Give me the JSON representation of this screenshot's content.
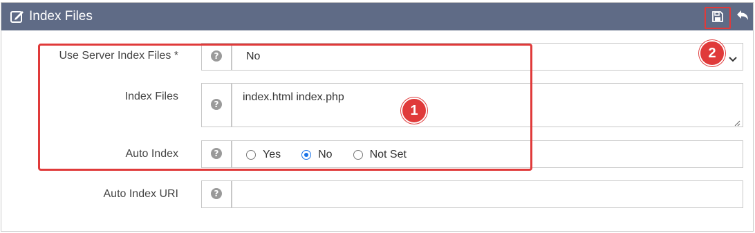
{
  "header": {
    "title": "Index Files",
    "icons": {
      "edit": "edit-icon",
      "save": "save-icon",
      "undo": "undo-icon"
    }
  },
  "fields": {
    "use_server_index": {
      "label": "Use Server Index Files *",
      "value": "No"
    },
    "index_files": {
      "label": "Index Files",
      "value": "index.html index.php"
    },
    "auto_index": {
      "label": "Auto Index",
      "options": [
        "Yes",
        "No",
        "Not Set"
      ],
      "selected": "No"
    },
    "auto_index_uri": {
      "label": "Auto Index URI",
      "value": ""
    }
  },
  "help_glyph": "?",
  "annotations": {
    "badge1": "1",
    "badge2": "2"
  },
  "colors": {
    "header_bg": "#5f6b86",
    "highlight": "#e03a3a",
    "radio_accent": "#1a73e8"
  }
}
